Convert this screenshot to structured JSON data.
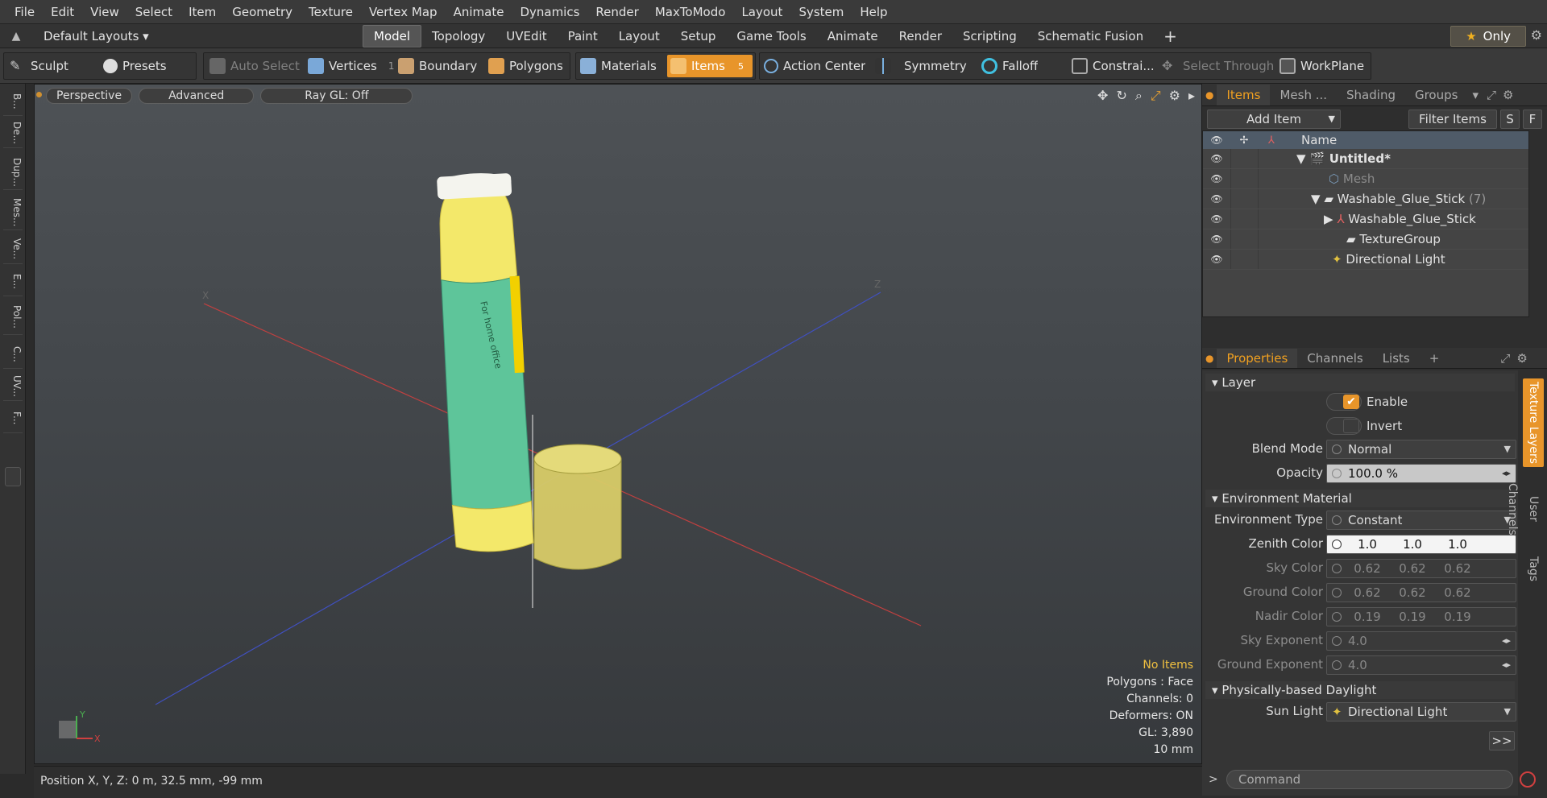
{
  "menu": [
    "File",
    "Edit",
    "View",
    "Select",
    "Item",
    "Geometry",
    "Texture",
    "Vertex Map",
    "Animate",
    "Dynamics",
    "Render",
    "MaxToModo",
    "Layout",
    "System",
    "Help"
  ],
  "layout_bar": {
    "default_layouts": "Default Layouts ▾",
    "tabs": [
      "Model",
      "Topology",
      "UVEdit",
      "Paint",
      "Layout",
      "Setup",
      "Game Tools",
      "Animate",
      "Render",
      "Scripting",
      "Schematic Fusion"
    ],
    "active_tab": "Model",
    "plus": "+",
    "only": "Only"
  },
  "toolbar": {
    "sculpt": "Sculpt",
    "presets": "Presets",
    "auto_select": "Auto Select",
    "vertices": "Vertices",
    "vertices_count": "1",
    "boundary": "Boundary",
    "polygons": "Polygons",
    "materials": "Materials",
    "items": "Items",
    "items_count": "5",
    "action_center": "Action Center",
    "symmetry": "Symmetry",
    "falloff": "Falloff",
    "constraints": "Constrai...",
    "select_through": "Select Through",
    "workplane": "WorkPlane"
  },
  "left_tools": [
    "B...",
    "De...",
    "Dup...",
    "Mes...",
    "Ve...",
    "E...",
    "Pol...",
    "C...",
    "UV...",
    "F..."
  ],
  "viewport": {
    "tabs": [
      "Perspective",
      "Advanced",
      "Ray GL: Off"
    ],
    "label_text": "For home office",
    "info": {
      "selection": "No Items",
      "polygons": "Polygons : Face",
      "channels": "Channels: 0",
      "deformers": "Deformers: ON",
      "gl": "GL: 3,890",
      "scale": "10 mm"
    },
    "axis_labels": {
      "x": "X",
      "y": "Y",
      "z": "Z"
    }
  },
  "status": {
    "position": "Position X, Y, Z:   0 m, 32.5 mm, -99 mm"
  },
  "items_panel": {
    "tabs": [
      "Items",
      "Mesh ...",
      "Shading",
      "Groups"
    ],
    "active_tab": "Items",
    "add_item": "Add Item",
    "filter_items": "Filter Items",
    "s": "S",
    "f": "F",
    "column_name": "Name",
    "rows": [
      {
        "name": "Untitled*",
        "indent": 0,
        "expander": "▼",
        "bold": true
      },
      {
        "name": "Mesh",
        "indent": 1,
        "expander": "",
        "dim": true
      },
      {
        "name": "Washable_Glue_Stick",
        "suffix": "(7)",
        "indent": 1,
        "expander": "▼"
      },
      {
        "name": "Washable_Glue_Stick",
        "indent": 2,
        "expander": "▶"
      },
      {
        "name": "TextureGroup",
        "indent": 2,
        "expander": ""
      },
      {
        "name": "Directional Light",
        "indent": 1,
        "expander": ""
      }
    ]
  },
  "properties_panel": {
    "tabs": [
      "Properties",
      "Channels",
      "Lists"
    ],
    "active_tab": "Properties",
    "plus": "+",
    "layer_section": "Layer",
    "enable": "Enable",
    "invert": "Invert",
    "blend_mode_label": "Blend Mode",
    "blend_mode_value": "Normal",
    "opacity_label": "Opacity",
    "opacity_value": "100.0 %",
    "env_section": "Environment Material",
    "env_type_label": "Environment Type",
    "env_type_value": "Constant",
    "zenith_label": "Zenith Color",
    "zenith_value": [
      "1.0",
      "1.0",
      "1.0"
    ],
    "sky_label": "Sky Color",
    "sky_value": [
      "0.62",
      "0.62",
      "0.62"
    ],
    "ground_label": "Ground Color",
    "ground_value": [
      "0.62",
      "0.62",
      "0.62"
    ],
    "nadir_label": "Nadir Color",
    "nadir_value": [
      "0.19",
      "0.19",
      "0.19"
    ],
    "sky_exp_label": "Sky Exponent",
    "sky_exp_value": "4.0",
    "ground_exp_label": "Ground Exponent",
    "ground_exp_value": "4.0",
    "daylight_section": "Physically-based Daylight",
    "sun_light_label": "Sun Light",
    "sun_light_value": "Directional Light",
    "more": ">>",
    "side_tabs": [
      "Texture Layers",
      "User Channels",
      "Tags"
    ]
  },
  "command": {
    "placeholder": "Command",
    "prompt": ">"
  },
  "colors": {
    "accent": "#e8952a",
    "selected_tab": "#f0a020",
    "info_yellow": "#f0c040"
  }
}
